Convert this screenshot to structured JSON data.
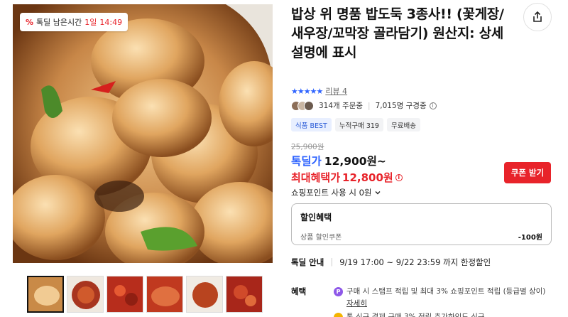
{
  "product": {
    "title": "밥상 위 명품 밥도둑 3종사!! (꽃게장/새우장/꼬막장 골라담기) 원산지: 상세설명에 표시",
    "rating_stars": "★★★★★",
    "review_label": "리뷰 4",
    "orders": "314개 주문중",
    "wishlist": "7,015명 구경중",
    "badges": [
      "식품 BEST",
      "누적구매 319",
      "무료배송"
    ],
    "original_price": "25,900원",
    "deal_label": "톡딜가",
    "deal_price": "12,900원~",
    "max_label": "최대혜택가",
    "max_price": "12,800원",
    "coupon_button": "쿠폰 받기",
    "points_label": "쇼핑포인트 사용 시 0원",
    "discount": {
      "heading": "할인혜택",
      "line_label": "상품 할인쿠폰",
      "line_amount": "-100원"
    },
    "deal_info_label": "톡딜 안내",
    "deal_info_value": "9/19 17:00 ~ 9/22 23:59 까지 한정할인",
    "benefit_label": "혜택",
    "benefit_text": "구매 시 스탬프 적립 및 최대 3% 쇼핑포인트 적립 (등급별 상이)",
    "benefit_link": "자세히",
    "benefit_text2": "톡 신규 결제 구매 3% 적립 추가하인드 신규"
  },
  "timer": {
    "label": "톡딜 남은시간",
    "days": "1일",
    "time": "14:49"
  },
  "icons": {
    "share": "share-icon",
    "info": "info-icon",
    "chevron": "chevron-down-icon"
  },
  "colors": {
    "accent_blue": "#2f64ff",
    "accent_red": "#e8232a"
  }
}
